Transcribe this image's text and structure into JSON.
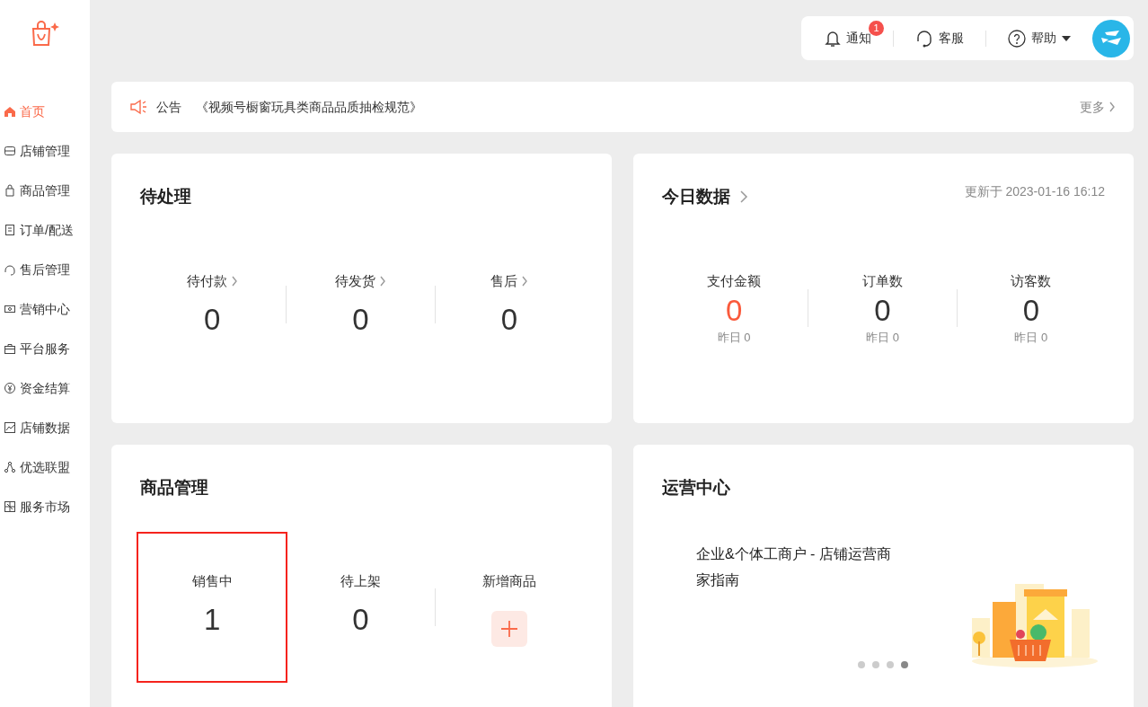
{
  "sidebar": {
    "items": [
      {
        "label": "首页",
        "selected": true
      },
      {
        "label": "店铺管理",
        "selected": false
      },
      {
        "label": "商品管理",
        "selected": false
      },
      {
        "label": "订单/配送",
        "selected": false
      },
      {
        "label": "售后管理",
        "selected": false
      },
      {
        "label": "营销中心",
        "selected": false
      },
      {
        "label": "平台服务",
        "selected": false
      },
      {
        "label": "资金结算",
        "selected": false
      },
      {
        "label": "店铺数据",
        "selected": false
      },
      {
        "label": "优选联盟",
        "selected": false
      },
      {
        "label": "服务市场",
        "selected": false
      }
    ]
  },
  "header": {
    "notifications": {
      "label": "通知",
      "badge": "1"
    },
    "service": {
      "label": "客服"
    },
    "help": {
      "label": "帮助"
    }
  },
  "notice": {
    "label": "公告",
    "text": "《视频号橱窗玩具类商品品质抽检规范》",
    "more": "更多"
  },
  "pending": {
    "title": "待处理",
    "stats": [
      {
        "label": "待付款",
        "value": "0",
        "link": true
      },
      {
        "label": "待发货",
        "value": "0",
        "link": true
      },
      {
        "label": "售后",
        "value": "0",
        "link": true
      }
    ]
  },
  "today": {
    "title": "今日数据",
    "updated": "更新于 2023-01-16 16:12",
    "stats": [
      {
        "label": "支付金额",
        "value": "0",
        "yesterday": "昨日 0",
        "accent": true
      },
      {
        "label": "订单数",
        "value": "0",
        "yesterday": "昨日 0",
        "accent": false
      },
      {
        "label": "访客数",
        "value": "0",
        "yesterday": "昨日 0",
        "accent": false
      }
    ]
  },
  "products": {
    "title": "商品管理",
    "stats": [
      {
        "kind": "count",
        "label": "销售中",
        "value": "1",
        "highlighted": true
      },
      {
        "kind": "count",
        "label": "待上架",
        "value": "0",
        "highlighted": false
      },
      {
        "kind": "add",
        "label": "新增商品"
      }
    ]
  },
  "operations": {
    "title": "运营中心",
    "article": "企业&个体工商户 - 店铺运营商家指南",
    "dots": [
      {
        "selected": false
      },
      {
        "selected": false
      },
      {
        "selected": false
      },
      {
        "selected": true
      }
    ]
  }
}
